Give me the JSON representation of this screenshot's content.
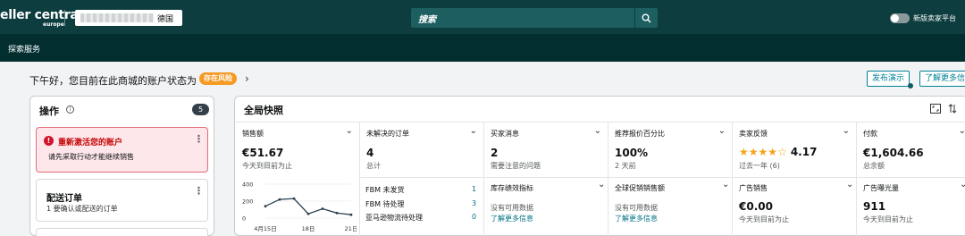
{
  "topbar": {
    "brand": "eller centra",
    "brand_sub": "europe",
    "store_country": "德国",
    "search_placeholder": "搜索",
    "toggle_label": "新版卖家平台"
  },
  "subnav": {
    "item": "探索服务"
  },
  "greeting": {
    "text": "下午好，您目前在此商城的账户状态为",
    "status_badge": "存在风险",
    "buttons": [
      "发布演示",
      "了解更多信"
    ]
  },
  "actions": {
    "title": "操作",
    "count": "5",
    "cards": [
      {
        "title": "重新激活您的账户",
        "subtitle": "请先采取行动才能继续销售"
      },
      {
        "title": "配送订单",
        "subtitle": "1 要确认或配送的订单"
      }
    ]
  },
  "snapshot": {
    "title": "全局快照",
    "metrics": [
      {
        "label": "销售额",
        "value": "€51.67",
        "sub": "今天到目前为止"
      },
      {
        "label": "未解决的订单",
        "value": "4",
        "sub": "总计"
      },
      {
        "label": "买家消息",
        "value": "2",
        "sub": "需要注意的问题"
      },
      {
        "label": "推荐报价百分比",
        "value": "100%",
        "sub": "2 天前"
      },
      {
        "label": "卖家反馈",
        "value": "4.17",
        "sub": "过去一年 (6)"
      },
      {
        "label": "付款",
        "value": "€1,604.66",
        "sub": "总余额"
      }
    ],
    "feedback_stars": 4.17,
    "fbm": [
      {
        "label": "FBM 未发货",
        "count": "1"
      },
      {
        "label": "FBM 待处理",
        "count": "3"
      },
      {
        "label": "亚马逊物流待处理",
        "count": "0"
      }
    ],
    "inventory": {
      "label": "库存绩效指标",
      "sub": "没有可用数据",
      "link": "了解更多信息"
    },
    "promo": {
      "label": "全球促销销售额",
      "sub": "没有可用数据",
      "link": "了解更多信息"
    },
    "ad_sales": {
      "label": "广告销售",
      "value": "€0.00",
      "sub": "今天到目前为止"
    },
    "ad_impressions": {
      "label": "广告曝光量",
      "value": "911",
      "sub": "今天到目前为止"
    }
  },
  "chart_data": {
    "type": "line",
    "x": [
      "4月15日",
      "",
      "",
      "18日",
      "",
      "",
      "21日"
    ],
    "xticks": [
      "4月15日",
      "18日",
      "21日"
    ],
    "yticks": [
      "400",
      "200",
      "0"
    ],
    "ylim": [
      0,
      400
    ],
    "values": [
      140,
      220,
      230,
      50,
      110,
      60,
      40
    ]
  }
}
